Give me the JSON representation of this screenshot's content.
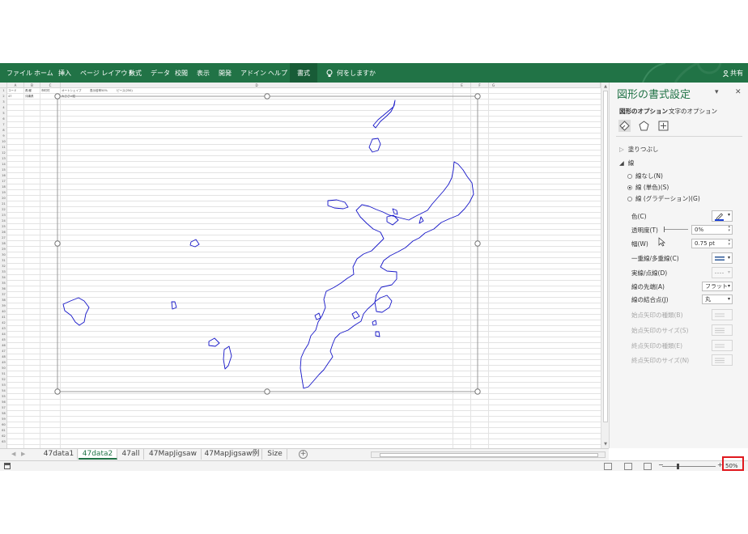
{
  "ribbon": {
    "tabs": [
      "ファイル",
      "ホーム",
      "挿入",
      "ページ レイアウト",
      "数式",
      "データ",
      "校閲",
      "表示",
      "開発",
      "アドイン",
      "ヘルプ",
      "書式"
    ],
    "active_tab": "書式",
    "tell_me": "何をしますか",
    "share": "共有",
    "accent_color": "#217346"
  },
  "sheet": {
    "columns": [
      "A",
      "B",
      "C",
      "D",
      "E",
      "F",
      "G"
    ],
    "row_numbers": [
      "1",
      "2",
      "3",
      "4",
      "5",
      "6",
      "7",
      "8",
      "9",
      "10",
      "11",
      "12",
      "13",
      "14",
      "15",
      "16",
      "17",
      "18",
      "19",
      "20",
      "21",
      "22",
      "23",
      "24",
      "25",
      "26",
      "27",
      "28",
      "29",
      "30",
      "31",
      "32",
      "33",
      "34",
      "35",
      "36",
      "37",
      "38",
      "39",
      "40",
      "41",
      "42",
      "43",
      "44",
      "45",
      "46",
      "47",
      "48",
      "49",
      "50",
      "51",
      "52",
      "53",
      "54",
      "55",
      "56",
      "57",
      "58",
      "59",
      "60",
      "61",
      "62",
      "63"
    ],
    "row1": [
      "コード",
      "県/都",
      "市町村",
      "オートシェイプ",
      "表示倍率50%",
      "ピース(250)"
    ],
    "row2": [
      "47",
      "沖縄県",
      "",
      "大きさ×縦"
    ],
    "shape_outline_color": "#1515c8"
  },
  "sheet_tabs": [
    "47data1",
    "47data2",
    "47all",
    "47MapJigsaw",
    "47MapJigsaw例",
    "Size"
  ],
  "active_sheet": "47data2",
  "status": {
    "zoom": "50%"
  },
  "pane": {
    "title": "図形の書式設定",
    "option_tabs": [
      "図形のオプション",
      "文字のオプション"
    ],
    "fill_section": "塗りつぶし",
    "line_section": "線",
    "line_options": [
      "線なし(N)",
      "線 (単色)(S)",
      "線 (グラデーション)(G)"
    ],
    "selected_line_option": "線 (単色)(S)",
    "props": {
      "color": "色(C)",
      "transparency": "透明度(T)",
      "width": "幅(W)",
      "compound": "一重線/多重線(C)",
      "dash": "実線/点線(D)",
      "cap": "線の先端(A)",
      "join": "線の結合点(J)",
      "begin_arrow_type": "始点矢印の種類(B)",
      "begin_arrow_size": "始点矢印のサイズ(S)",
      "end_arrow_type": "終点矢印の種類(E)",
      "end_arrow_size": "終点矢印のサイズ(N)"
    },
    "values": {
      "transparency": "0%",
      "width": "0.75 pt",
      "cap": "フラット",
      "join": "丸"
    },
    "line_color": "#1a3fd6"
  }
}
